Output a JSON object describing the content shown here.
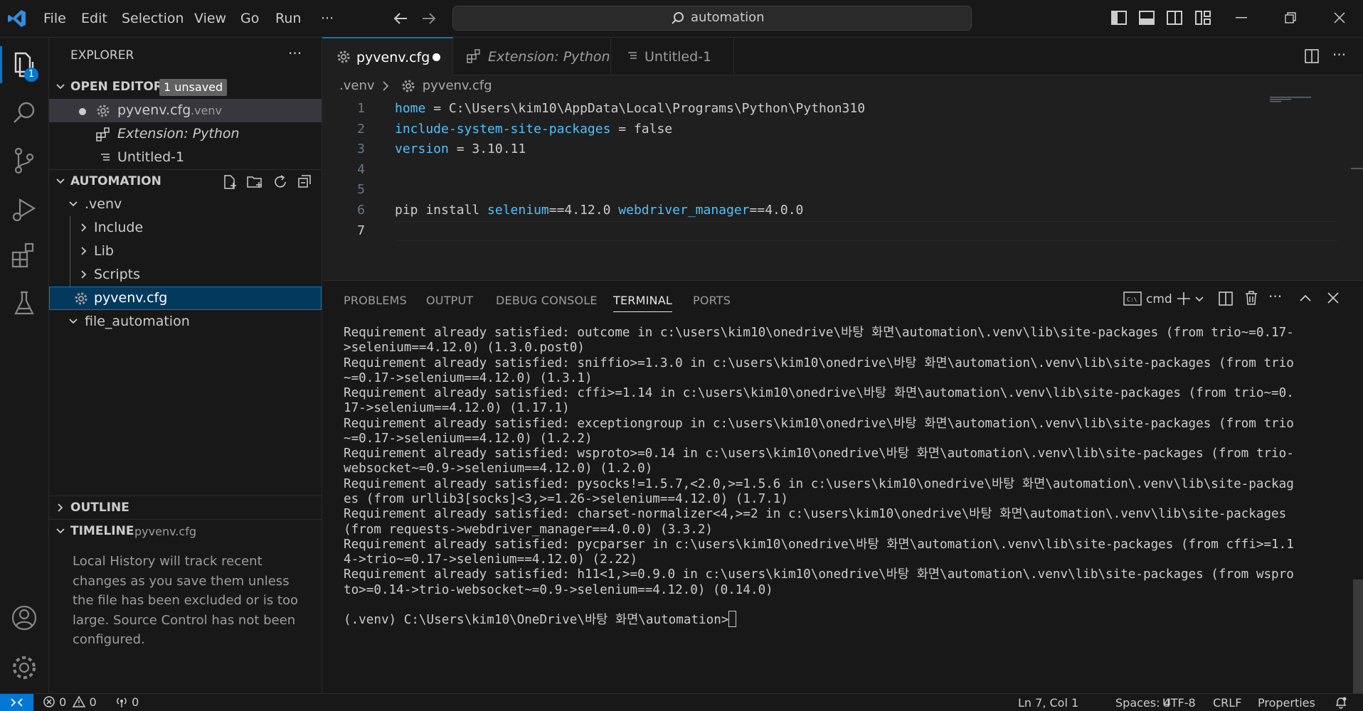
{
  "titlebar": {
    "menus": [
      "File",
      "Edit",
      "Selection",
      "View",
      "Go",
      "Run",
      "···"
    ],
    "search_text": "automation"
  },
  "activity": {
    "explorer_badge": "1"
  },
  "sidebar": {
    "title": "EXPLORER",
    "more": "···",
    "open_editors": {
      "label": "OPEN EDITORS",
      "badge": "1 unsaved",
      "items": [
        {
          "name": "pyvenv.cfg",
          "desc": ".venv"
        },
        {
          "name": "Extension: Python",
          "desc": ""
        },
        {
          "name": "Untitled-1",
          "desc": ""
        }
      ]
    },
    "folder": {
      "label": "AUTOMATION",
      "tree": [
        ".venv",
        "Include",
        "Lib",
        "Scripts",
        "pyvenv.cfg",
        "file_automation"
      ]
    },
    "outline": "OUTLINE",
    "timeline": {
      "label": "TIMELINE",
      "file": "pyvenv.cfg",
      "message_lines": [
        "Local History will track recent",
        "changes as you save them unless",
        "the file has been excluded or is too",
        "large. Source Control has not been",
        "configured."
      ]
    }
  },
  "editor": {
    "tabs": [
      "pyvenv.cfg",
      "Extension: Python",
      "Untitled-1"
    ],
    "breadcrumb": [
      ".venv",
      "pyvenv.cfg"
    ],
    "lines": [
      {
        "n": "1",
        "key": "home",
        "rest": " = C:\\Users\\kim10\\AppData\\Local\\Programs\\Python\\Python310"
      },
      {
        "n": "2",
        "key": "include-system-site-packages",
        "rest": " = false"
      },
      {
        "n": "3",
        "key": "version",
        "rest": " = 3.10.11"
      },
      {
        "n": "4",
        "key": "",
        "rest": ""
      },
      {
        "n": "5",
        "key": "",
        "rest": ""
      },
      {
        "n": "6",
        "pre": "pip install ",
        "k1": "selenium",
        "m1": "==4.12.0 ",
        "k2": "webdriver_manager",
        "m2": "==4.0.0"
      },
      {
        "n": "7",
        "key": "",
        "rest": ""
      }
    ]
  },
  "panel": {
    "tabs": [
      "PROBLEMS",
      "OUTPUT",
      "DEBUG CONSOLE",
      "TERMINAL",
      "PORTS"
    ],
    "terminal_name": "cmd",
    "lines": [
      "Requirement already satisfied: outcome in c:\\users\\kim10\\onedrive\\바탕 화면\\automation\\.venv\\lib\\site-packages (from trio~=0.17-",
      ">selenium==4.12.0) (1.3.0.post0)",
      "Requirement already satisfied: sniffio>=1.3.0 in c:\\users\\kim10\\onedrive\\바탕 화면\\automation\\.venv\\lib\\site-packages (from trio",
      "~=0.17->selenium==4.12.0) (1.3.1)",
      "Requirement already satisfied: cffi>=1.14 in c:\\users\\kim10\\onedrive\\바탕 화면\\automation\\.venv\\lib\\site-packages (from trio~=0.",
      "17->selenium==4.12.0) (1.17.1)",
      "Requirement already satisfied: exceptiongroup in c:\\users\\kim10\\onedrive\\바탕 화면\\automation\\.venv\\lib\\site-packages (from trio",
      "~=0.17->selenium==4.12.0) (1.2.2)",
      "Requirement already satisfied: wsproto>=0.14 in c:\\users\\kim10\\onedrive\\바탕 화면\\automation\\.venv\\lib\\site-packages (from trio-",
      "websocket~=0.9->selenium==4.12.0) (1.2.0)",
      "Requirement already satisfied: pysocks!=1.5.7,<2.0,>=1.5.6 in c:\\users\\kim10\\onedrive\\바탕 화면\\automation\\.venv\\lib\\site-packag",
      "es (from urllib3[socks]<3,>=1.26->selenium==4.12.0) (1.7.1)",
      "Requirement already satisfied: charset-normalizer<4,>=2 in c:\\users\\kim10\\onedrive\\바탕 화면\\automation\\.venv\\lib\\site-packages",
      "(from requests->webdriver_manager==4.0.0) (3.3.2)",
      "Requirement already satisfied: pycparser in c:\\users\\kim10\\onedrive\\바탕 화면\\automation\\.venv\\lib\\site-packages (from cffi>=1.1",
      "4->trio~=0.17->selenium==4.12.0) (2.22)",
      "Requirement already satisfied: h11<1,>=0.9.0 in c:\\users\\kim10\\onedrive\\바탕 화면\\automation\\.venv\\lib\\site-packages (from wspro",
      "to>=0.14->trio-websocket~=0.9->selenium==4.12.0) (0.14.0)",
      "",
      "(.venv) C:\\Users\\kim10\\OneDrive\\바탕 화면\\automation>"
    ]
  },
  "status": {
    "errors": "0",
    "warnings": "0",
    "ports": "0",
    "position": "Ln 7, Col 1",
    "spaces": "Spaces: 4",
    "encoding": "UTF-8",
    "eol": "CRLF",
    "language": "Properties"
  },
  "colors": {
    "accent": "#0078d4",
    "keyword": "#4fc1ff",
    "background": "#1f1f1f",
    "sidebar": "#181818"
  }
}
